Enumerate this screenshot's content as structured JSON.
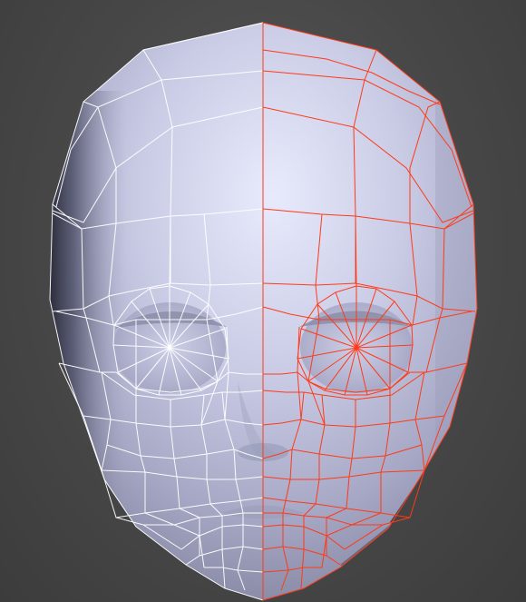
{
  "scene": {
    "object": "head-mesh",
    "selection": "right-half-selected",
    "colors": {
      "background": "#4a4a4a",
      "surface_light": "#e4e6fa",
      "surface_mid": "#b9bbd6",
      "surface_dark": "#2a2b3a",
      "wire_unselected": "#ffffff",
      "wire_selected": "#ff3a18"
    }
  }
}
